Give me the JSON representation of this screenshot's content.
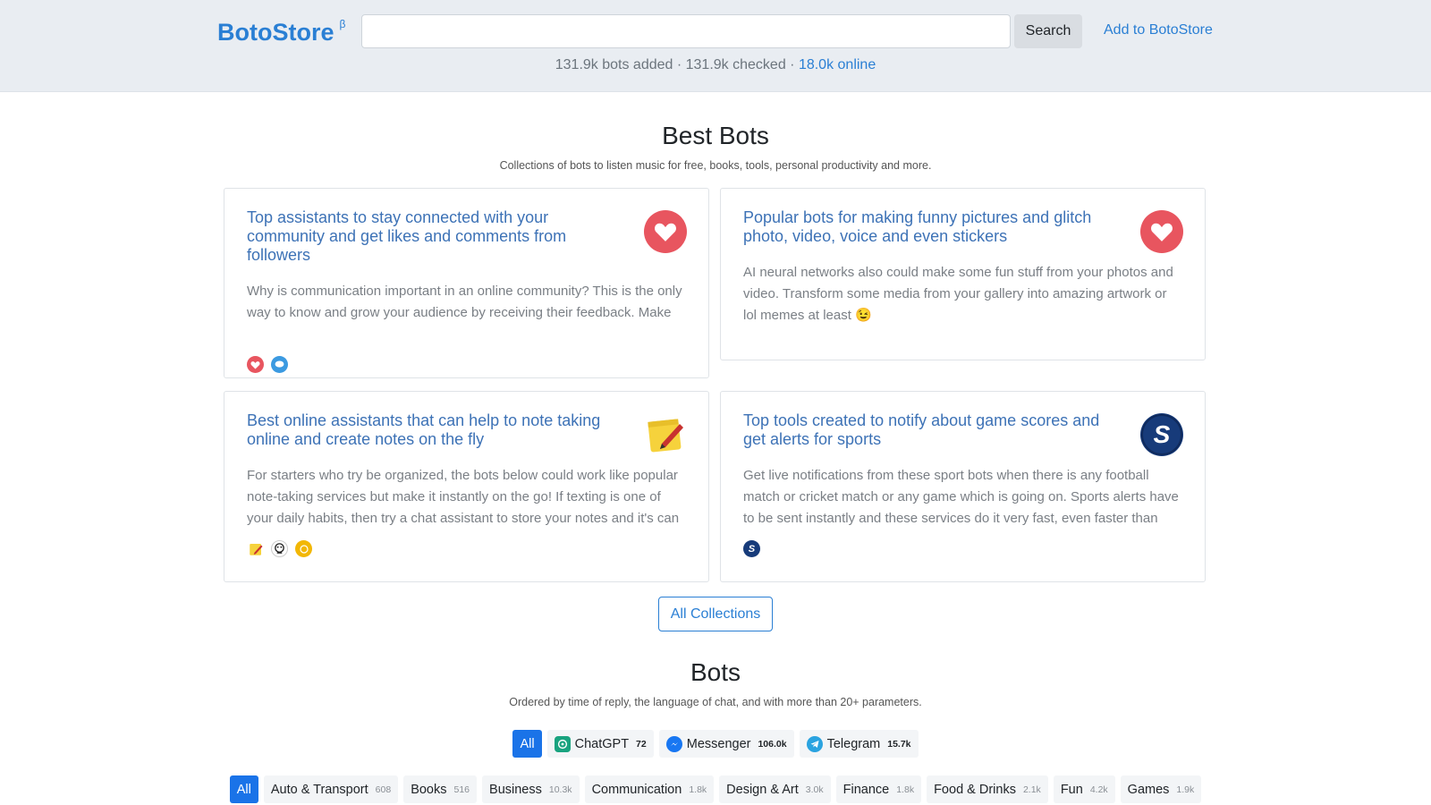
{
  "header": {
    "logo": "BotoStore",
    "logo_sup": "β",
    "search_placeholder": "",
    "search_button": "Search",
    "add_link": "Add to BotoStore",
    "stats_prefix": "131.9k bots added · 131.9k checked · ",
    "stats_online": "18.0k online"
  },
  "best": {
    "title": "Best Bots",
    "subtitle": "Collections of bots to listen music for free, books, tools, personal productivity and more.",
    "cards": [
      {
        "title": "Top assistants to stay connected with your community and get likes and comments from followers",
        "desc": "Why is communication important in an online community? This is the only way to know and grow your audience by receiving their feedback. Make",
        "icon": "heart-icon"
      },
      {
        "title": "Popular bots for making funny pictures and glitch photo, video, voice and even stickers",
        "desc": "AI neural networks also could make some fun stuff from your photos and video. Transform some media from your gallery into amazing artwork or lol memes at least 😉",
        "icon": "heart-icon"
      },
      {
        "title": "Best online assistants that can help to note taking online and create notes on the fly",
        "desc": "For starters who try be organized, the bots below could work like popular note-taking services but make it instantly on the go! If texting is one of your daily habits, then try a chat assistant to store your notes and it's can",
        "icon": "notepad-icon"
      },
      {
        "title": "Top tools created to notify about game scores and get alerts for sports",
        "desc": "Get live notifications from these sport bots when there is any football match or cricket match or any game which is going on. Sports alerts have to be sent instantly and these services do it very fast, even faster than",
        "icon": "sports-s-icon"
      }
    ],
    "all_collections": "All Collections"
  },
  "bots": {
    "title": "Bots",
    "subtitle": "Ordered by time of reply, the language of chat, and with more than 20+ parameters.",
    "platforms": [
      {
        "label": "All",
        "count": ""
      },
      {
        "label": "ChatGPT",
        "count": "72"
      },
      {
        "label": "Messenger",
        "count": "106.0k"
      },
      {
        "label": "Telegram",
        "count": "15.7k"
      }
    ],
    "categories": [
      {
        "label": "All",
        "count": ""
      },
      {
        "label": "Auto & Transport",
        "count": "608"
      },
      {
        "label": "Books",
        "count": "516"
      },
      {
        "label": "Business",
        "count": "10.3k"
      },
      {
        "label": "Communication",
        "count": "1.8k"
      },
      {
        "label": "Design & Art",
        "count": "3.0k"
      },
      {
        "label": "Finance",
        "count": "1.8k"
      },
      {
        "label": "Food & Drinks",
        "count": "2.1k"
      },
      {
        "label": "Fun",
        "count": "4.2k"
      },
      {
        "label": "Games",
        "count": "1.9k"
      }
    ]
  },
  "colors": {
    "brand": "#2a7fd4",
    "active_pill": "#1a73e8",
    "heart": "#e8555f"
  }
}
